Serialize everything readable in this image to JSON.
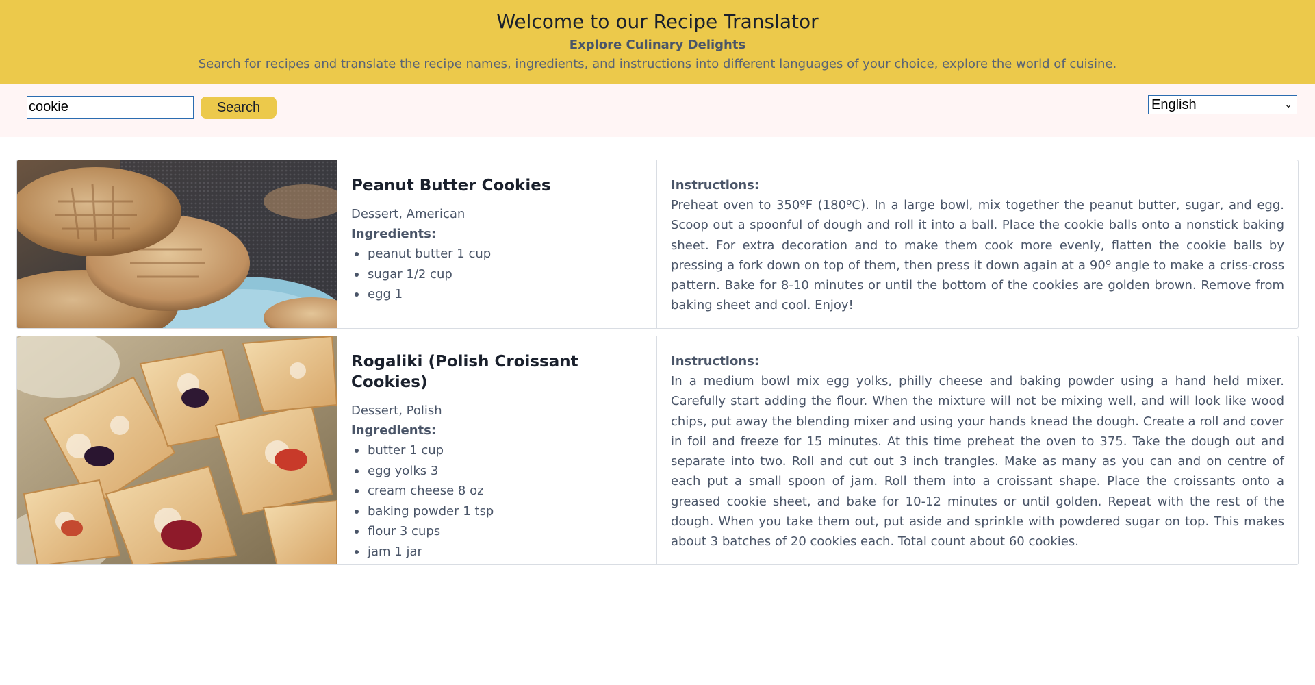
{
  "header": {
    "title": "Welcome to our Recipe Translator",
    "subtitle": "Explore Culinary Delights",
    "description": "Search for recipes and translate the recipe names, ingredients, and instructions into different languages of your choice, explore the world of cuisine."
  },
  "toolbar": {
    "search_value": "cookie",
    "search_button": "Search",
    "language": "English"
  },
  "labels": {
    "ingredients": "Ingredients:",
    "instructions": "Instructions:"
  },
  "recipes": [
    {
      "name": "Peanut Butter Cookies",
      "category": "Dessert, American",
      "ingredients": [
        "peanut butter 1 cup",
        "sugar 1/2 cup",
        "egg 1"
      ],
      "instructions": "Preheat oven to 350ºF (180ºC). In a large bowl, mix together the peanut butter, sugar, and egg. Scoop out a spoonful of dough and roll it into a ball. Place the cookie balls onto a nonstick baking sheet. For extra decoration and to make them cook more evenly, flatten the cookie balls by pressing a fork down on top of them, then press it down again at a 90º angle to make a criss-cross pattern. Bake for 8-10 minutes or until the bottom of the cookies are golden brown. Remove from baking sheet and cool. Enjoy!"
    },
    {
      "name": "Rogaliki (Polish Croissant Cookies)",
      "category": "Dessert, Polish",
      "ingredients": [
        "butter 1 cup",
        "egg yolks 3",
        "cream cheese 8 oz",
        "baking powder 1 tsp",
        "flour 3 cups",
        "jam 1 jar"
      ],
      "instructions": "In a medium bowl mix egg yolks, philly cheese and baking powder using a hand held mixer. Carefully start adding the flour. When the mixture will not be mixing well, and will look like wood chips, put away the blending mixer and using your hands knead the dough. Create a roll and cover in foil and freeze for 15 minutes. At this time preheat the oven to 375. Take the dough out and separate into two. Roll and cut out 3 inch trangles. Make as many as you can and on centre of each put a small spoon of jam. Roll them into a croissant shape. Place the croissants onto a greased cookie sheet, and bake for 10-12 minutes or until golden. Repeat with the rest of the dough. When you take them out, put aside and sprinkle with powdered sugar on top. This makes about 3 batches of 20 cookies each. Total count about 60 cookies."
    }
  ]
}
